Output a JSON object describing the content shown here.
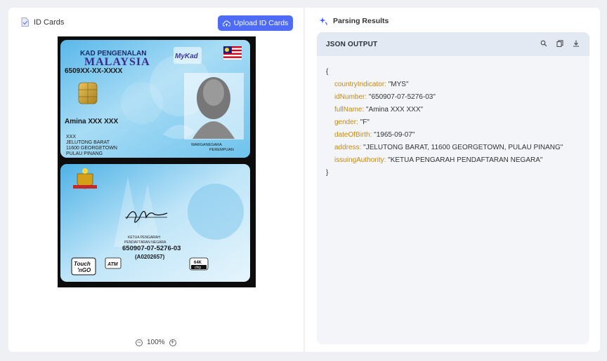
{
  "left": {
    "title": "ID Cards",
    "upload_label": "Upload ID Cards",
    "zoom": "100%"
  },
  "card_front": {
    "header1": "KAD PENGENALAN",
    "header2": "MALAYSIA",
    "badge": "MyKad",
    "id_number": "6509XX-XX-XXXX",
    "name": "Amina XXX XXX",
    "addr1": "XXX",
    "addr2": "JELUTONG BARAT",
    "addr3": "11600 GEORGETOWN",
    "addr4": "PULAU PINANG",
    "status1": "WARGANEGARA",
    "status2": "PEREMPUAN"
  },
  "card_back": {
    "sig_title1": "KETUA PENGARAH",
    "sig_title2": "PENDAFTARAN NEGARA",
    "number": "650907-07-5276-03",
    "serial": "(A0202657)",
    "logo1": "Touch",
    "logo2": "'nGO",
    "atm": "ATM",
    "chip1": "64K",
    "chip2": "chip"
  },
  "right": {
    "title": "Parsing Results",
    "json_header": "JSON OUTPUT",
    "open_brace": "{",
    "close_brace": "}",
    "fields": [
      {
        "key": "countryIndicator:",
        "value": "\"MYS\""
      },
      {
        "key": "idNumber:",
        "value": "\"650907-07-5276-03\""
      },
      {
        "key": "fullName:",
        "value": "\"Amina XXX XXX\""
      },
      {
        "key": "gender:",
        "value": "\"F\""
      },
      {
        "key": "dateOfBirth:",
        "value": "\"1965-09-07\""
      },
      {
        "key": "address:",
        "value": "\"JELUTONG BARAT, 11600 GEORGETOWN, PULAU PINANG\""
      },
      {
        "key": "issuingAuthority:",
        "value": "\"KETUA PENGARAH PENDAFTARAN NEGARA\""
      }
    ]
  },
  "colors": {
    "accent": "#4e6bf5",
    "json_key": "#c68a0e"
  },
  "icons": [
    "document-icon",
    "cloud-upload-icon",
    "zoom-out-icon",
    "zoom-in-icon",
    "sparkle-icon",
    "search-icon",
    "copy-icon",
    "download-icon"
  ]
}
